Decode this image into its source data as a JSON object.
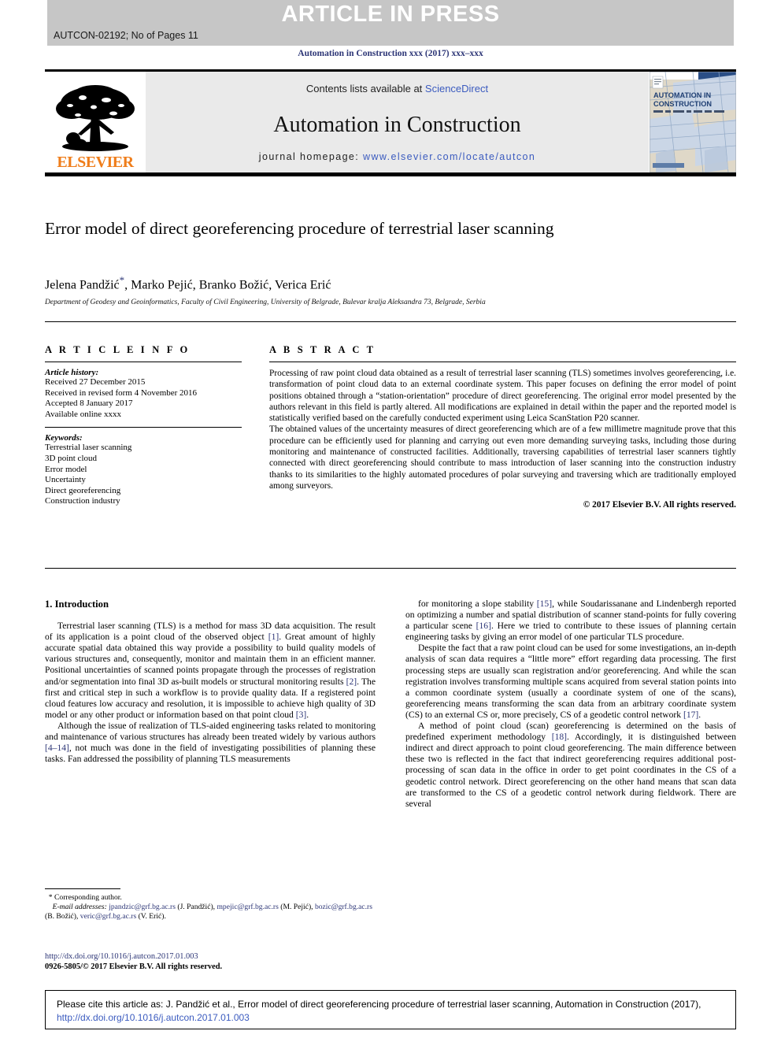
{
  "banner": {
    "press_label": "ARTICLE IN PRESS",
    "article_code": "AUTCON-02192; No of Pages 11"
  },
  "running_head": "Automation in Construction xxx (2017) xxx–xxx",
  "masthead": {
    "contents_prefix": "Contents lists available at ",
    "contents_link": "ScienceDirect",
    "journal_name": "Automation in Construction",
    "homepage_prefix": "journal homepage: ",
    "homepage_url": "www.elsevier.com/locate/autcon",
    "publisher_wordmark": "ELSEVIER",
    "cover_title_line1": "AUTOMATION IN",
    "cover_title_line2": "CONSTRUCTION"
  },
  "article": {
    "title": "Error model of direct georeferencing procedure of terrestrial laser scanning",
    "authors": "Jelena Pandžić",
    "authors_rest": ", Marko Pejić, Branko Božić, Verica Erić",
    "corresponding_marker": "*",
    "affiliation": "Department of Geodesy and Geoinformatics, Faculty of Civil Engineering, University of Belgrade, Bulevar kralja Aleksandra 73, Belgrade, Serbia"
  },
  "info": {
    "heading": "A R T I C L E   I N F O",
    "history_label": "Article history:",
    "history": [
      "Received 27 December 2015",
      "Received in revised form 4 November 2016",
      "Accepted 8 January 2017",
      "Available online xxxx"
    ],
    "keywords_label": "Keywords:",
    "keywords": [
      "Terrestrial laser scanning",
      "3D point cloud",
      "Error model",
      "Uncertainty",
      "Direct georeferencing",
      "Construction industry"
    ]
  },
  "abstract": {
    "heading": "A B S T R A C T",
    "paragraph1": "Processing of raw point cloud data obtained as a result of terrestrial laser scanning (TLS) sometimes involves georeferencing, i.e. transformation of point cloud data to an external coordinate system. This paper focuses on defining the error model of point positions obtained through a “station-orientation” procedure of direct georeferencing. The original error model presented by the authors relevant in this field is partly altered. All modifications are explained in detail within the paper and the reported model is statistically verified based on the carefully conducted experiment using Leica ScanStation P20 scanner.",
    "paragraph2": "The obtained values of the uncertainty measures of direct georeferencing which are of a few millimetre magnitude prove that this procedure can be efficiently used for planning and carrying out even more demanding surveying tasks, including those during monitoring and maintenance of constructed facilities. Additionally, traversing capabilities of terrestrial laser scanners tightly connected with direct georeferencing should contribute to mass introduction of laser scanning into the construction industry thanks to its similarities to the highly automated procedures of polar surveying and traversing which are traditionally employed among surveyors.",
    "copyright": "© 2017 Elsevier B.V. All rights reserved."
  },
  "body": {
    "section_heading": "1. Introduction",
    "left_paragraphs": [
      "Terrestrial laser scanning (TLS) is a method for mass 3D data acquisition. The result of its application is a point cloud of the observed object [1]. Great amount of highly accurate spatial data obtained this way provide a possibility to build quality models of various structures and, consequently, monitor and maintain them in an efficient manner. Positional uncertainties of scanned points propagate through the processes of registration and/or segmentation into final 3D as-built models or structural monitoring results [2]. The first and critical step in such a workflow is to provide quality data. If a registered point cloud features low accuracy and resolution, it is impossible to achieve high quality of 3D model or any other product or information based on that point cloud [3].",
      "Although the issue of realization of TLS-aided engineering tasks related to monitoring and maintenance of various structures has already been treated widely by various authors [4–14], not much was done in the field of investigating possibilities of planning these tasks. Fan addressed the possibility of planning TLS measurements"
    ],
    "right_paragraphs": [
      "for monitoring a slope stability [15], while Soudarissanane and Lindenbergh reported on optimizing a number and spatial distribution of scanner stand-points for fully covering a particular scene [16]. Here we tried to contribute to these issues of planning certain engineering tasks by giving an error model of one particular TLS procedure.",
      "Despite the fact that a raw point cloud can be used for some investigations, an in-depth analysis of scan data requires a “little more” effort regarding data processing. The first processing steps are usually scan registration and/or georeferencing. And while the scan registration involves transforming multiple scans acquired from several station points into a common coordinate system (usually a coordinate system of one of the scans), georeferencing means transforming the scan data from an arbitrary coordinate system (CS) to an external CS or, more precisely, CS of a geodetic control network [17].",
      "A method of point cloud (scan) georeferencing is determined on the basis of predefined experiment methodology [18]. Accordingly, it is distinguished between indirect and direct approach to point cloud georeferencing. The main difference between these two is reflected in the fact that indirect georeferencing requires additional post-processing of scan data in the office in order to get point coordinates in the CS of a geodetic control network. Direct georeferencing on the other hand means that scan data are transformed to the CS of a geodetic control network during fieldwork. There are several"
    ]
  },
  "footnote": {
    "corresponding": "Corresponding author.",
    "email_label": "E-mail addresses:",
    "emails": [
      {
        "address": "jpandzic@grf.bg.ac.rs",
        "name": "(J. Pandžić)"
      },
      {
        "address": "mpejic@grf.bg.ac.rs",
        "name": "(M. Pejić)"
      },
      {
        "address": "bozic@grf.bg.ac.rs",
        "name": "(B. Božić)"
      },
      {
        "address": "veric@grf.bg.ac.rs",
        "name": "(V. Erić)"
      }
    ]
  },
  "doi_block": {
    "doi_url": "http://dx.doi.org/10.1016/j.autcon.2017.01.003",
    "issn_line": "0926-5805/© 2017 Elsevier B.V. All rights reserved."
  },
  "citation": {
    "prefix": "Please cite this article as: J. Pandžić et al., Error model of direct georeferencing procedure of terrestrial laser scanning,  Automation in Construction (2017), ",
    "link": "http://dx.doi.org/10.1016/j.autcon.2017.01.003"
  },
  "colors": {
    "banner_bg": "#c6c6c6",
    "link_blue": "#2c3576",
    "elsevier_orange": "#ef7d1a",
    "contents_bg": "#eaeaea"
  }
}
